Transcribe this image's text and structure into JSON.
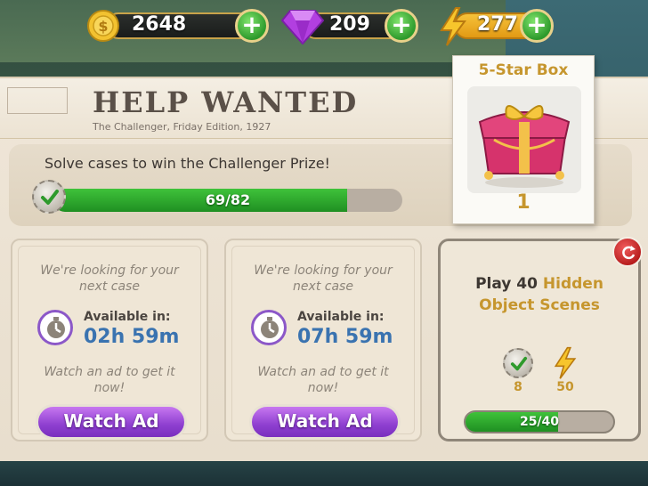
{
  "currencies": {
    "coins": {
      "value": "2648",
      "icon": "coin-icon"
    },
    "gems": {
      "value": "209",
      "icon": "gem-icon"
    },
    "energy": {
      "value": "277",
      "icon": "bolt-icon"
    }
  },
  "header": {
    "title": "HELP WANTED",
    "edition": "The Challenger, Friday Edition, 1927"
  },
  "objective": {
    "text": "Solve cases to win the Challenger Prize!",
    "progress_label": "69/82",
    "progress_current": 69,
    "progress_total": 82
  },
  "prize": {
    "title": "5-Star Box",
    "count": "1"
  },
  "cases": [
    {
      "line1": "We're looking for your",
      "line2": "next case",
      "available_label": "Available in:",
      "available_time": "02h 59m",
      "ad_line1": "Watch an ad to get it",
      "ad_line2": "now!",
      "button_label": "Watch Ad"
    },
    {
      "line1": "We're looking for your",
      "line2": "next case",
      "available_label": "Available in:",
      "available_time": "07h 59m",
      "ad_line1": "Watch an ad to get it",
      "ad_line2": "now!",
      "button_label": "Watch Ad"
    }
  ],
  "task": {
    "title_prefix": "Play 40",
    "title_highlight_1": "Hidden",
    "title_highlight_2": "Object Scenes",
    "reward_check": "8",
    "reward_energy": "50",
    "progress_label": "25/40",
    "progress_current": 25,
    "progress_total": 40
  },
  "colors": {
    "accent_gold": "#c6962e",
    "button_purple": "#8e3fd0",
    "progress_green": "#3fc23a",
    "timer_blue": "#3a73b0"
  }
}
